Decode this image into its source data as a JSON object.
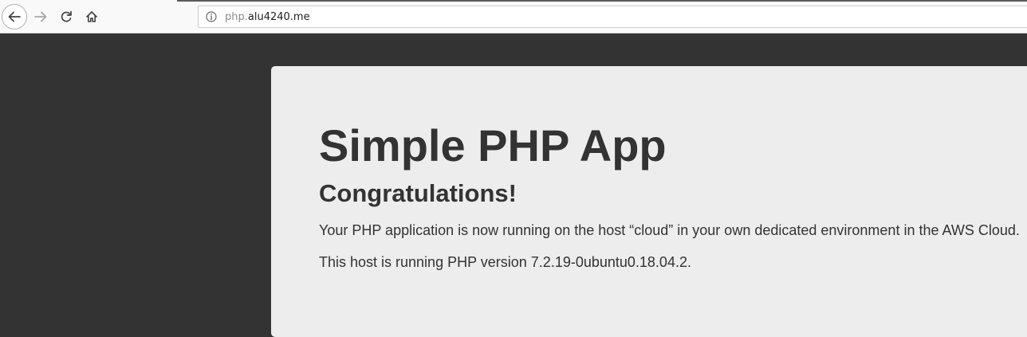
{
  "browser": {
    "url_subdomain": "php.",
    "url_domain": "alu4240.me",
    "icons": [
      "back-icon",
      "forward-icon",
      "reload-icon",
      "home-icon",
      "info-icon"
    ]
  },
  "page": {
    "title": "Simple PHP App",
    "subtitle": "Congratulations!",
    "message": "Your PHP application is now running on the host “cloud” in your own dedicated environment in the AWS Cloud.",
    "version_text": "This host is running PHP version 7.2.19-0ubuntu0.18.04.2."
  },
  "colors": {
    "background": "#333333",
    "card": "#ededed",
    "text": "#333333"
  }
}
